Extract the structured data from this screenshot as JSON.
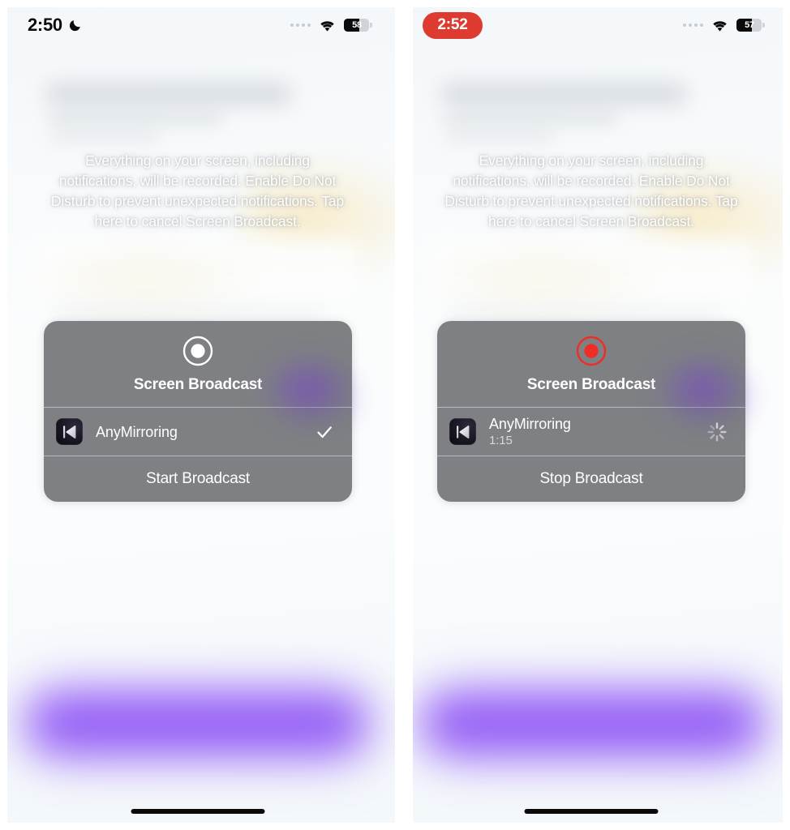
{
  "meta": {
    "accent_red": "#dd3b30",
    "accent_purple": "#8b4ef5",
    "dialog_bg": "#74767a"
  },
  "phones": [
    {
      "id": "left",
      "status_bar": {
        "time": "2:50",
        "time_style": "plain",
        "moon_icon": "crescent-moon-icon",
        "signal_icon": "cellular-dots-icon",
        "wifi_icon": "wifi-icon",
        "battery_icon": "battery-icon",
        "battery_percent": "58"
      },
      "warning_text": "Everything on your screen, including notifications, will be recorded. Enable Do Not Disturb to prevent unexpected notifications. Tap here to cancel Screen Broadcast.",
      "dialog": {
        "record_icon": "record-circle-icon",
        "record_icon_color": "#ffffff",
        "title": "Screen Broadcast",
        "app": {
          "icon": "anymirroring-app-icon",
          "name": "AnyMirroring",
          "subtitle": "",
          "trailing_icon": "checkmark-icon"
        },
        "action_label": "Start Broadcast"
      }
    },
    {
      "id": "right",
      "status_bar": {
        "time": "2:52",
        "time_style": "recording-pill",
        "moon_icon": "",
        "signal_icon": "cellular-dots-icon",
        "wifi_icon": "wifi-icon",
        "battery_icon": "battery-icon",
        "battery_percent": "57"
      },
      "warning_text": "Everything on your screen, including notifications, will be recorded. Enable Do Not Disturb to prevent unexpected notifications. Tap here to cancel Screen Broadcast.",
      "dialog": {
        "record_icon": "record-circle-icon",
        "record_icon_color": "#ef2d24",
        "title": "Screen Broadcast",
        "app": {
          "icon": "anymirroring-app-icon",
          "name": "AnyMirroring",
          "subtitle": "1:15",
          "trailing_icon": "activity-spinner-icon"
        },
        "action_label": "Stop Broadcast"
      }
    }
  ]
}
